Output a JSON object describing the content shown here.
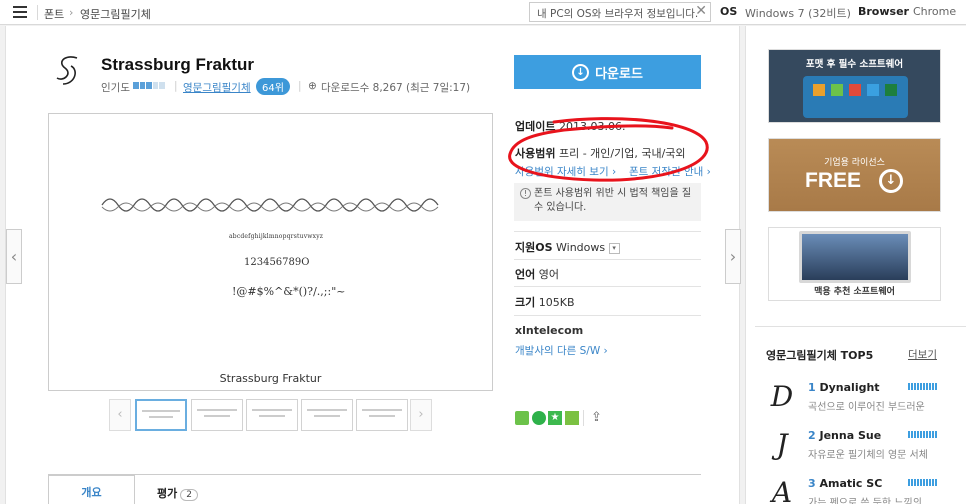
{
  "topbar": {
    "breadcrumb": [
      "폰트",
      "영문그림필기체"
    ],
    "breadcrumb_sep": "›",
    "search_placeholder": "내 PC의 OS와 브라우저 정보입니다.",
    "os_label": "OS",
    "os_value": "Windows 7 (32비트)",
    "browser_label": "Browser",
    "browser_value": "Chrome"
  },
  "font": {
    "name": "Strassburg Fraktur",
    "popularity_label": "인기도",
    "popularity_level": 0.6,
    "category": "영문그림필기체",
    "rank": "64위",
    "downloads": "다운로드수 8,267 (최근 7일:17)"
  },
  "preview": {
    "caption": "Strassburg Fraktur",
    "line2": "abcdefghijklmnopqrstuvwxyz",
    "line3": "123456789O",
    "line4": "!@#$%^&*()?/.,;:\"~"
  },
  "download_button": {
    "label": "다운로드"
  },
  "details": {
    "update_label": "업데이트",
    "update_value": "2013.03.06.",
    "usage_label": "사용범위",
    "usage_value": "프리 - 개인/기업, 국내/국외",
    "usage_link": "사용범위 자세히 보기 ›",
    "copyright_link": "폰트 저작권 안내 ›",
    "warning_text": "폰트 사용범위 위반 시 법적 책임을 질 수 있습니다.",
    "os_label": "지원OS",
    "os_value": "Windows",
    "lang_label": "언어",
    "lang_value": "영어",
    "size_label": "크기",
    "size_value": "105KB",
    "developer": "xlntelecom",
    "developer_link": "개발사의 다른 S/W ›"
  },
  "tabs": [
    {
      "label": "개요"
    },
    {
      "label": "평가",
      "count": "2"
    }
  ],
  "sidebar": {
    "ad1": "포맷 후 필수 소프트웨어",
    "ad2_small": "기업용 라이선스",
    "ad2_big": "FREE",
    "ad3": "맥용 추천 소프트웨어",
    "top5_title": "영문그림필기체 TOP5",
    "top5_more": "더보기",
    "top5": [
      {
        "rank": "1",
        "name": "Dynalight",
        "desc": "곡선으로 이루어진 부드러운",
        "glyph": "D"
      },
      {
        "rank": "2",
        "name": "Jenna Sue",
        "desc": "자유로운 필기체의 영문 서체",
        "glyph": "J"
      },
      {
        "rank": "3",
        "name": "Amatic SC",
        "desc": "가는 펜으로 쓴 듯한 느낌의",
        "glyph": "A"
      }
    ]
  },
  "colors": {
    "accent": "#3d9ee0",
    "annotation": "#e8131c"
  }
}
